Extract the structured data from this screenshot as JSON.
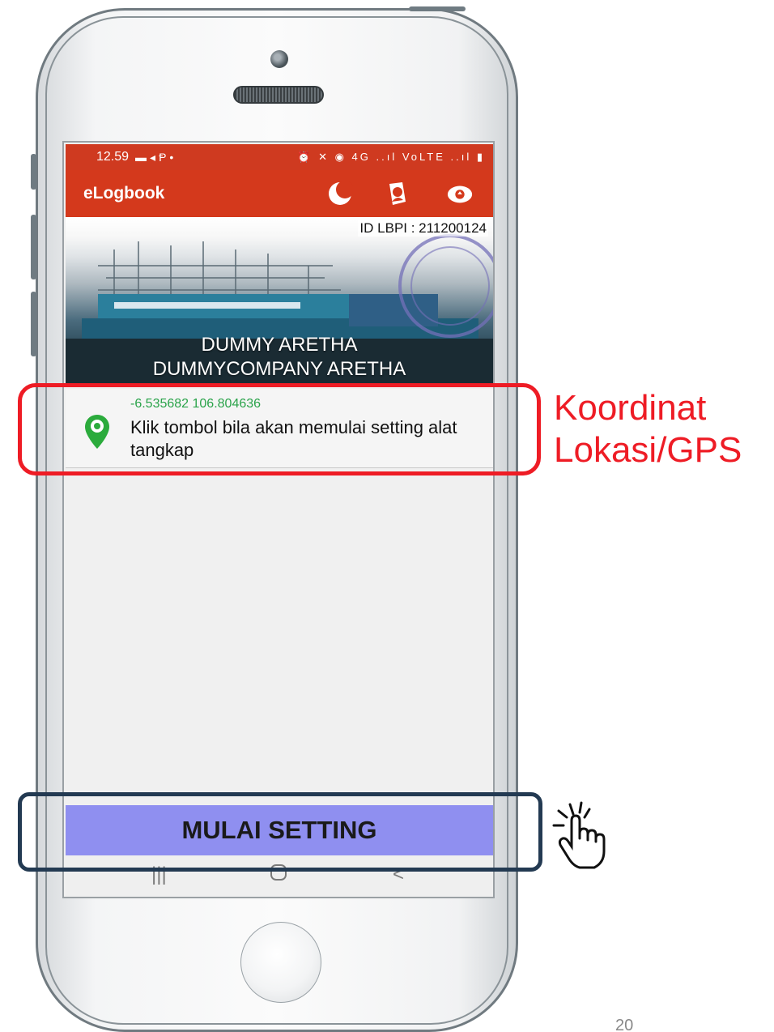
{
  "status_bar": {
    "time": "12.59",
    "left_icons": [
      "message-icon",
      "telegram-icon",
      "parking-icon",
      "dot-icon"
    ],
    "right_icons": "⏰ ✕ ◉ 4G ..ıl VoLTE ..ıl ▮"
  },
  "app_bar": {
    "title": "eLogbook",
    "actions": [
      "moon-icon",
      "bell-person-icon",
      "cloud-sync-icon"
    ]
  },
  "banner": {
    "id_label": "ID LBPI : 211200124",
    "line1": "DUMMY ARETHA",
    "line2": "DUMMYCOMPANY ARETHA"
  },
  "gps": {
    "coordinates": "-6.535682 106.804636",
    "message": "Klik tombol bila akan memulai setting alat tangkap"
  },
  "action_button": {
    "label": "MULAI SETTING"
  },
  "callouts": {
    "gps_label_line1": "Koordinat",
    "gps_label_line2": "Lokasi/GPS"
  },
  "page_number": "20",
  "colors": {
    "app_bar": "#d4391c",
    "button": "#8f8ff0",
    "coords_text": "#2aa34a",
    "callout_red": "#ee1c25",
    "callout_blue": "#233a52"
  }
}
